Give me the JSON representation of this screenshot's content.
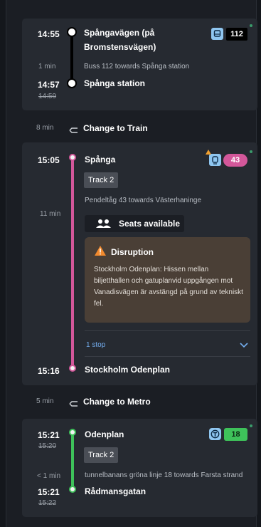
{
  "leg1": {
    "dep_time": "14:55",
    "from_stop_line1": "Spångavägen (på",
    "from_stop_line2": "Bromstensvägen)",
    "duration": "1 min",
    "description": "Buss 112 towards Spånga station",
    "arr_time": "14:57",
    "arr_time_planned": "14:59",
    "to_stop": "Spånga station",
    "line_number": "112",
    "mode_icon": "bus-icon",
    "line_color": "#000000",
    "badge_bg": "#000000"
  },
  "change1": {
    "duration": "8 min",
    "label": "Change to Train",
    "icon": "change-icon"
  },
  "leg2": {
    "dep_time": "15:05",
    "from_stop": "Spånga",
    "track": "Track 2",
    "description": "Pendeltåg 43 towards Västerhaninge",
    "duration": "11 min",
    "seats": "Seats available",
    "seats_icon": "people-icon",
    "disruption": {
      "title": "Disruption",
      "icon": "warning-icon",
      "body": "Stockholm Odenplan: Hissen mellan biljetthallen och gatuplanvid uppgången mot Vanadisvägen är avstängd på grund av tekniskt fel."
    },
    "stops_link": "1 stop",
    "arr_time": "15:16",
    "to_stop": "Stockholm Odenplan",
    "line_number": "43",
    "mode_icon": "train-icon",
    "line_color": "#d3579a"
  },
  "change2": {
    "duration": "5 min",
    "label": "Change to Metro",
    "icon": "change-icon"
  },
  "leg3": {
    "dep_time": "15:21",
    "dep_time_planned": "15:20",
    "from_stop": "Odenplan",
    "track": "Track 2",
    "duration": "< 1 min",
    "description": "tunnelbanans gröna linje 18 towards Farsta strand",
    "arr_time": "15:21",
    "arr_time_planned": "15:22",
    "to_stop": "Rådmansgatan",
    "line_number": "18",
    "mode_icon": "metro-icon",
    "line_color": "#3ec25a"
  }
}
